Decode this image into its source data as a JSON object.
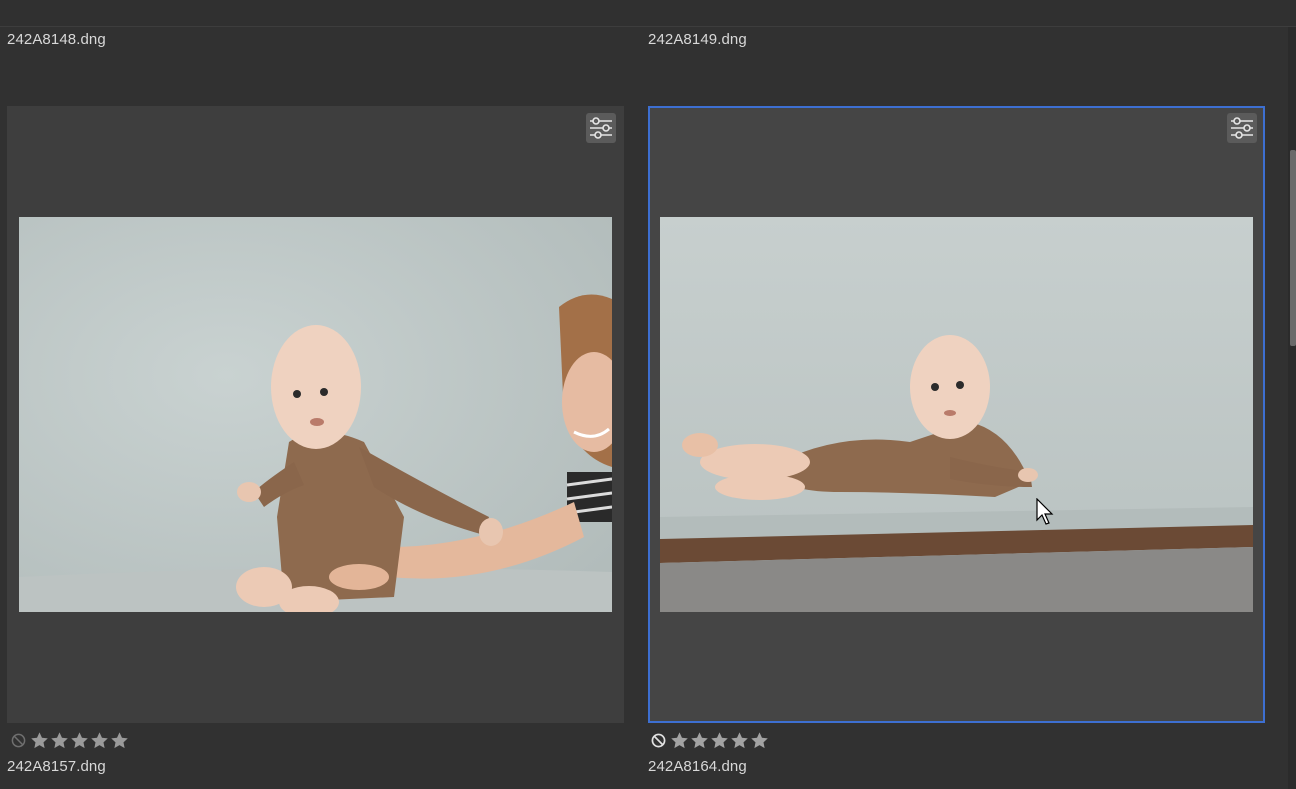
{
  "grid": {
    "top_row": [
      {
        "filename": "242A8148.dng"
      },
      {
        "filename": "242A8149.dng"
      }
    ],
    "cells": [
      {
        "filename": "242A8157.dng",
        "selected": false,
        "rejected": false,
        "rating": 0,
        "max_rating": 5,
        "image": "baby sitting with mother smiling on right",
        "edit_icon": "sliders-icon"
      },
      {
        "filename": "242A8164.dng",
        "selected": true,
        "rejected": true,
        "rating": 0,
        "max_rating": 5,
        "image": "baby lying on stomach on studio floor",
        "edit_icon": "sliders-icon"
      }
    ]
  },
  "colors": {
    "background": "#313131",
    "cell": "#3e3e3e",
    "selection_border": "#3d6fd1"
  }
}
